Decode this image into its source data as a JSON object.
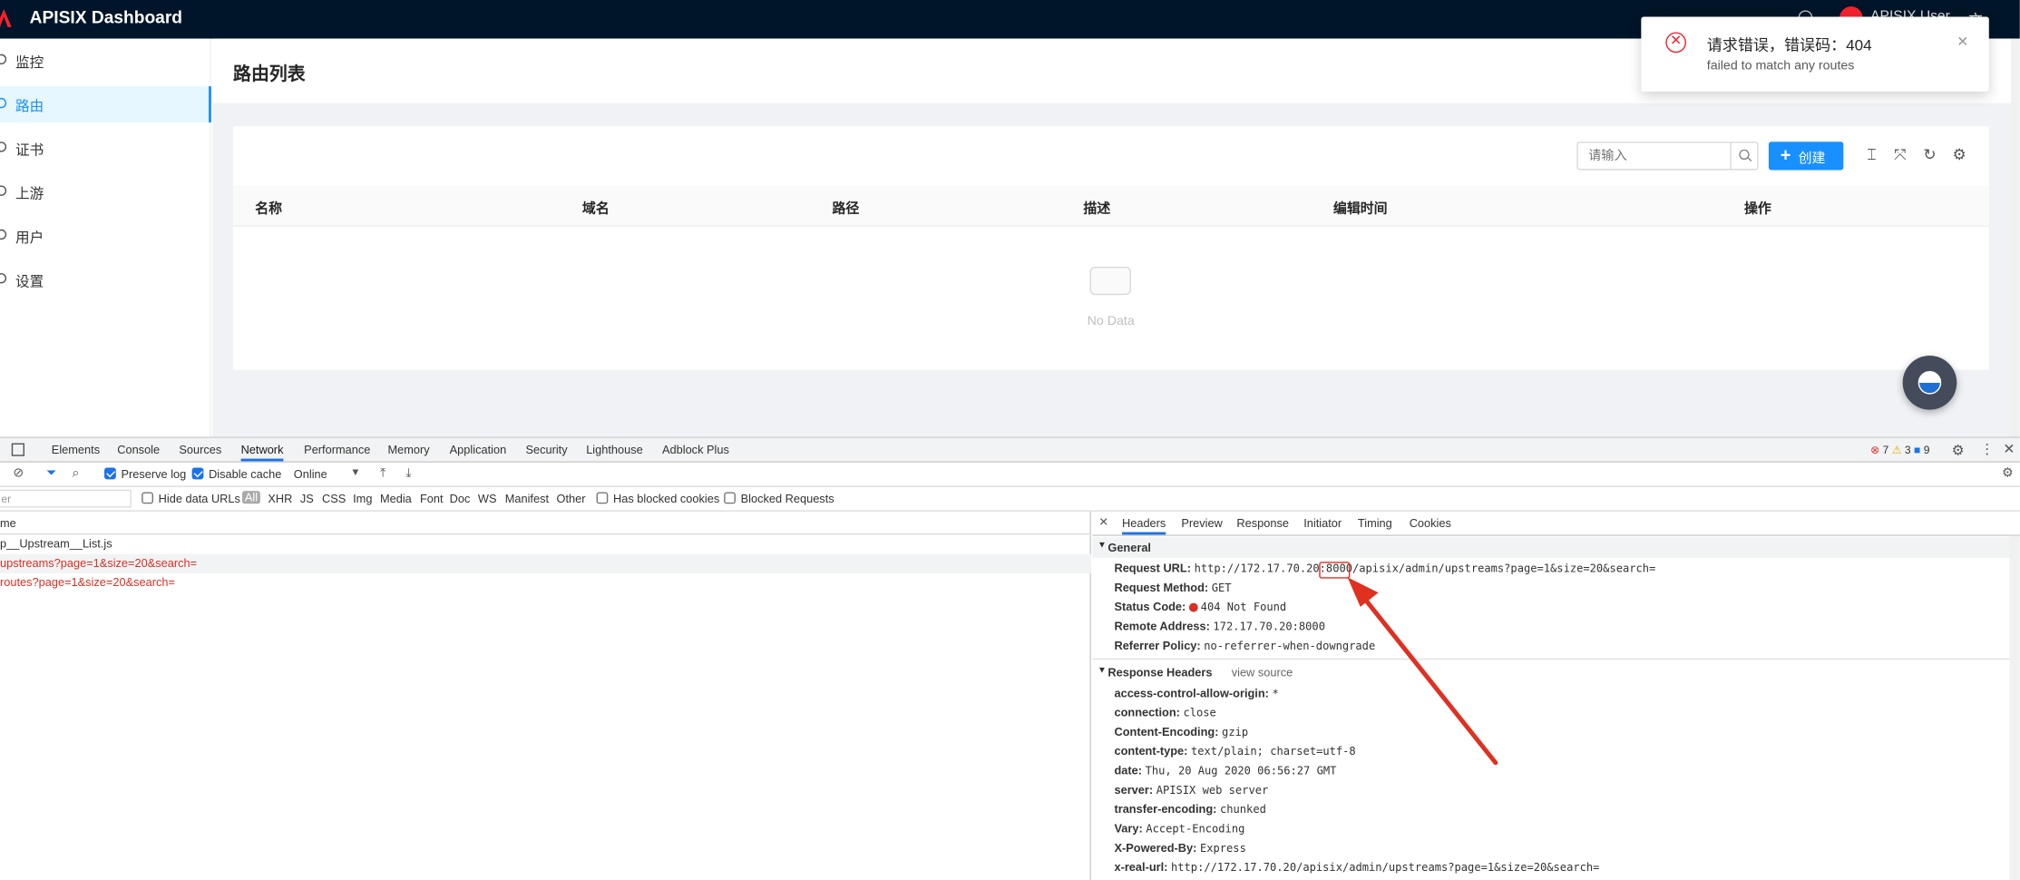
{
  "header": {
    "app_title": "APISIX Dashboard",
    "user_name": "APISIX User",
    "lang_icon": "文"
  },
  "sidebar": {
    "items": [
      {
        "label": "监控",
        "icon": "dashboard-icon"
      },
      {
        "label": "路由",
        "icon": "route-icon"
      },
      {
        "label": "证书",
        "icon": "certificate-icon"
      },
      {
        "label": "上游",
        "icon": "upstream-icon"
      },
      {
        "label": "用户",
        "icon": "user-icon"
      },
      {
        "label": "设置",
        "icon": "settings-icon"
      }
    ]
  },
  "main": {
    "page_title": "路由列表",
    "search_placeholder": "请输入",
    "create_label": "创建",
    "columns": [
      "名称",
      "域名",
      "路径",
      "描述",
      "编辑时间",
      "操作"
    ],
    "empty_text": "No Data"
  },
  "notification": {
    "title": "请求错误，错误码：404",
    "description": "failed to match any routes"
  },
  "devtools": {
    "tabs": [
      "Elements",
      "Console",
      "Sources",
      "Network",
      "Performance",
      "Memory",
      "Application",
      "Security",
      "Lighthouse",
      "Adblock Plus"
    ],
    "active_tab": "Network",
    "error_count": "7",
    "warning_count": "3",
    "message_count": "9",
    "toolbar": {
      "preserve_log": "Preserve log",
      "disable_cache": "Disable cache",
      "throttle": "Online"
    },
    "filter": {
      "placeholder": "er",
      "hide_data_urls": "Hide data URLs",
      "types": [
        "All",
        "XHR",
        "JS",
        "CSS",
        "Img",
        "Media",
        "Font",
        "Doc",
        "WS",
        "Manifest",
        "Other"
      ],
      "has_blocked_cookies": "Has blocked cookies",
      "blocked_requests": "Blocked Requests"
    },
    "requests": {
      "column": "me",
      "rows": [
        "p__Upstream__List.js",
        "upstreams?page=1&size=20&search=",
        "routes?page=1&size=20&search="
      ]
    },
    "detail_tabs": [
      "Headers",
      "Preview",
      "Response",
      "Initiator",
      "Timing",
      "Cookies"
    ],
    "general": {
      "title": "General",
      "rows": [
        {
          "k": "Request URL:",
          "v": "http://172.17.70.20:8000/apisix/admin/upstreams?page=1&size=20&search="
        },
        {
          "k": "Request Method:",
          "v": "GET"
        },
        {
          "k": "Status Code:",
          "v": "404 Not Found"
        },
        {
          "k": "Remote Address:",
          "v": "172.17.70.20:8000"
        },
        {
          "k": "Referrer Policy:",
          "v": "no-referrer-when-downgrade"
        }
      ]
    },
    "response_headers": {
      "title": "Response Headers",
      "view_source": "view source",
      "rows": [
        {
          "k": "access-control-allow-origin:",
          "v": "*"
        },
        {
          "k": "connection:",
          "v": "close"
        },
        {
          "k": "Content-Encoding:",
          "v": "gzip"
        },
        {
          "k": "content-type:",
          "v": "text/plain; charset=utf-8"
        },
        {
          "k": "date:",
          "v": "Thu, 20 Aug 2020 06:56:27 GMT"
        },
        {
          "k": "server:",
          "v": "APISIX web server"
        },
        {
          "k": "transfer-encoding:",
          "v": "chunked"
        },
        {
          "k": "Vary:",
          "v": "Accept-Encoding"
        },
        {
          "k": "X-Powered-By:",
          "v": "Express"
        },
        {
          "k": "x-real-url:",
          "v": "http://172.17.70.20/apisix/admin/upstreams?page=1&size=20&search="
        }
      ]
    }
  },
  "colors": {
    "header_bg": "#001529",
    "primary": "#1890ff",
    "error": "#f5222d",
    "annotation": "#e03020"
  }
}
